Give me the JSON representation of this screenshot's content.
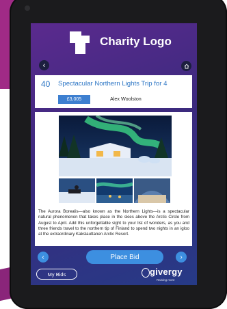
{
  "header": {
    "logo_text": "Charity Logo"
  },
  "item": {
    "lot_number": "40",
    "title": "Spectacular Northern Lights Trip for 4",
    "current_bid": "£3,005",
    "bidder_name": "Alex Woolston",
    "description": "The Aurora Borealis—also known as the Northern Lights—is a spectacular natural phenomenon that takes place in the skies above the Arctic Circle from August to April. Add this unforgettable sight to your list of wonders, as you and three friends travel to the northern tip of Finland to spend two nights in an igloo at the extraordinary Kakslauttanen Arctic Resort."
  },
  "actions": {
    "place_bid": "Place Bid",
    "my_bids": "My Bids"
  },
  "footer": {
    "brand": "givergy",
    "tagline": "Raising more"
  },
  "colors": {
    "accent": "#3d8fe0",
    "title_blue": "#2a74c4",
    "screen_top": "#5b2a8e",
    "screen_bottom": "#263a86"
  }
}
